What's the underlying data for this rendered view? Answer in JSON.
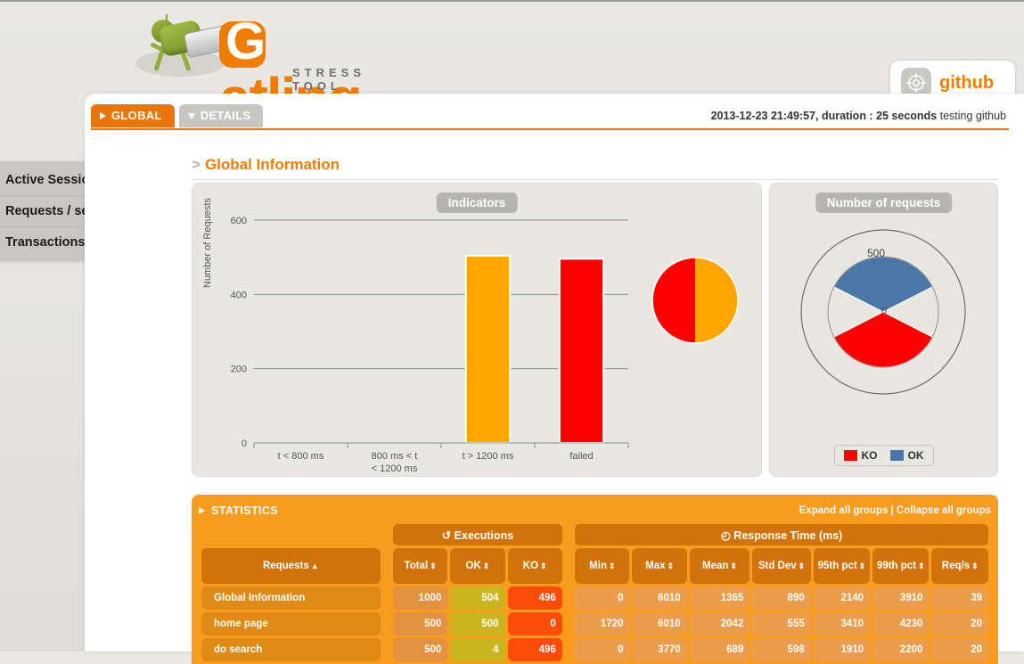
{
  "brand": {
    "name": "Gatling",
    "tagline": "STRESS TOOL",
    "logo_letter": "G",
    "logo_rest": "atling",
    "gun_icon": "gatling-gun-icon"
  },
  "github_badge": {
    "label": "github",
    "icon": "crosshair-target-icon"
  },
  "sidebar": {
    "items": [
      {
        "label": "Active Sessions"
      },
      {
        "label": "Requests / sec"
      },
      {
        "label": "Transactions / sec"
      }
    ]
  },
  "tabs": [
    {
      "label": "GLOBAL",
      "active": true,
      "icon": "triangle-right-icon"
    },
    {
      "label": "DETAILS",
      "active": false,
      "icon": "triangle-down-icon"
    }
  ],
  "run_info": {
    "bold": "2013-12-23 21:49:57, duration : 25 seconds",
    "normal": " testing github"
  },
  "page_title": {
    "chevron": ">",
    "text": "Global Information"
  },
  "statistics": {
    "header_label": "STATISTICS",
    "expand_link": "Expand all groups",
    "separator": " | ",
    "collapse_link": "Collapse all groups",
    "groups": [
      {
        "label": "Executions",
        "icon": "refresh-icon"
      },
      {
        "label": "Response Time (ms)",
        "icon": "clock-icon"
      }
    ],
    "columns": [
      {
        "label": "Requests",
        "sort": "▲"
      },
      {
        "label": "Total",
        "sort": "⇕"
      },
      {
        "label": "OK",
        "sort": "⇕"
      },
      {
        "label": "KO",
        "sort": "⇕"
      },
      {
        "label": "Min",
        "sort": "⇕"
      },
      {
        "label": "Max",
        "sort": "⇕"
      },
      {
        "label": "Mean",
        "sort": "⇕"
      },
      {
        "label": "Std Dev",
        "sort": "⇕"
      },
      {
        "label": "95th pct",
        "sort": "⇕"
      },
      {
        "label": "99th pct",
        "sort": "⇕"
      },
      {
        "label": "Req/s",
        "sort": "⇕"
      }
    ],
    "rows": [
      {
        "name": "Global Information",
        "total": "1000",
        "ok": "504",
        "ko": "496",
        "min": "0",
        "max": "6010",
        "mean": "1365",
        "stddev": "890",
        "p95": "2140",
        "p99": "3910",
        "reqs": "39"
      },
      {
        "name": "home page",
        "total": "500",
        "ok": "500",
        "ko": "0",
        "min": "1720",
        "max": "6010",
        "mean": "2042",
        "stddev": "555",
        "p95": "3410",
        "p99": "4230",
        "reqs": "20"
      },
      {
        "name": "do search",
        "total": "500",
        "ok": "4",
        "ko": "496",
        "min": "0",
        "max": "3770",
        "mean": "689",
        "stddev": "598",
        "p95": "1910",
        "p99": "2200",
        "reqs": "20"
      }
    ]
  },
  "chart_data": [
    {
      "type": "bar",
      "title": "Indicators",
      "xlabel": "",
      "ylabel": "Number of Requests",
      "categories": [
        "t < 800 ms",
        "800 ms < t < 1200 ms",
        "t > 1200 ms",
        "failed"
      ],
      "values": [
        0,
        0,
        504,
        496
      ],
      "colors": [
        "#73c900",
        "#ffd700",
        "#ffa500",
        "#ff0000"
      ],
      "ylim": [
        0,
        600
      ],
      "yticks": [
        0,
        200,
        400,
        600
      ],
      "grid": true,
      "legend": "none",
      "pie_inset": {
        "type": "pie",
        "labels": [
          "failed",
          "t > 1200 ms"
        ],
        "values": [
          496,
          504
        ],
        "colors": [
          "#ff0000",
          "#ffa500"
        ]
      }
    },
    {
      "type": "pie",
      "title": "Number of requests",
      "labels": [
        "KO",
        "OK"
      ],
      "values": [
        496,
        504
      ],
      "colors": [
        "#ff0000",
        "#4a76a8"
      ],
      "radial_max_label": "500",
      "radial_min_label": "0",
      "legend": "bottom",
      "legend_entries": [
        {
          "label": "KO",
          "color": "#ff0000"
        },
        {
          "label": "OK",
          "color": "#4a76a8"
        }
      ]
    }
  ],
  "colors": {
    "accent": "#f07d00",
    "tab_active": "#e8760b",
    "tab_inactive": "#c8c6c0",
    "stats_bg": "#f79c1e",
    "stats_header": "#d2730a",
    "ok": "#cbb520",
    "ko": "#fb4c09",
    "page_bg": "#e7e6e0"
  }
}
